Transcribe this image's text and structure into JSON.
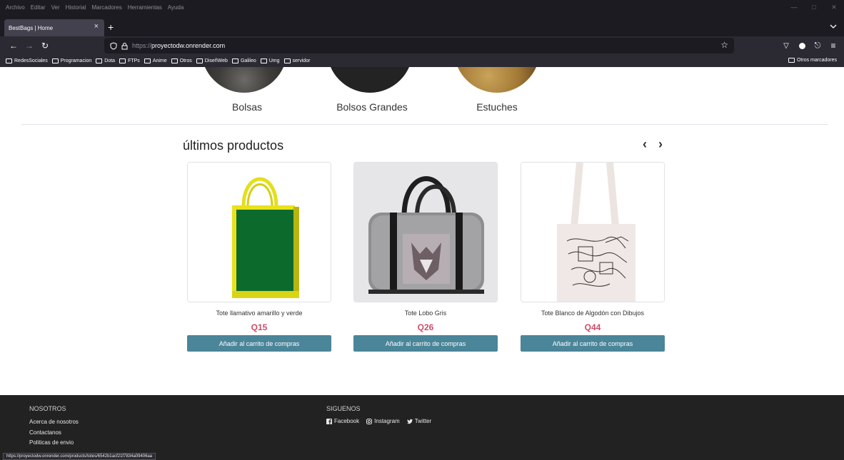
{
  "menubar": {
    "items": [
      "Archivo",
      "Editar",
      "Ver",
      "Historial",
      "Marcadores",
      "Herramientas",
      "Ayuda"
    ]
  },
  "tab": {
    "title": "BestBags | Home"
  },
  "address": {
    "proto": "https://",
    "host": "proyectodw.onrender.com"
  },
  "bookmarks": {
    "items": [
      "RedesSociales",
      "Programacion",
      "Dota",
      "FTPs",
      "Anime",
      "Otros",
      "DiseñWeb",
      "Galileo",
      "Umg",
      "servidor"
    ],
    "other": "Otros marcadores"
  },
  "categories": [
    {
      "label": "Bolsas"
    },
    {
      "label": "Bolsos Grandes"
    },
    {
      "label": "Estuches"
    }
  ],
  "section": {
    "title": "últimos productos"
  },
  "products": [
    {
      "name": "Tote llamativo amarillo y verde",
      "price": "Q15",
      "button": "Añadir al carrito de compras"
    },
    {
      "name": "Tote Lobo Gris",
      "price": "Q26",
      "button": "Añadir al carrito de compras"
    },
    {
      "name": "Tote Blanco de Algodón con Dibujos",
      "price": "Q44",
      "button": "Añadir al carrito de compras"
    }
  ],
  "footer": {
    "about_heading": "NOSOTROS",
    "about_links": [
      "Acerca de nosotros",
      "Contactanos",
      "Politicas de envio"
    ],
    "social_heading": "SIGUENOS",
    "social_links": [
      "Facebook",
      "Instagram",
      "Twitter"
    ]
  },
  "status": {
    "url": "https://proyectodw.onrender.com/products/totes/6542b1acf21f7834a09406aa"
  },
  "colors": {
    "accent_button": "#4a8599",
    "price": "#d04c6a",
    "footer_bg": "#222222",
    "chrome_dark": "#1c1b22",
    "chrome_mid": "#2b2a33"
  }
}
